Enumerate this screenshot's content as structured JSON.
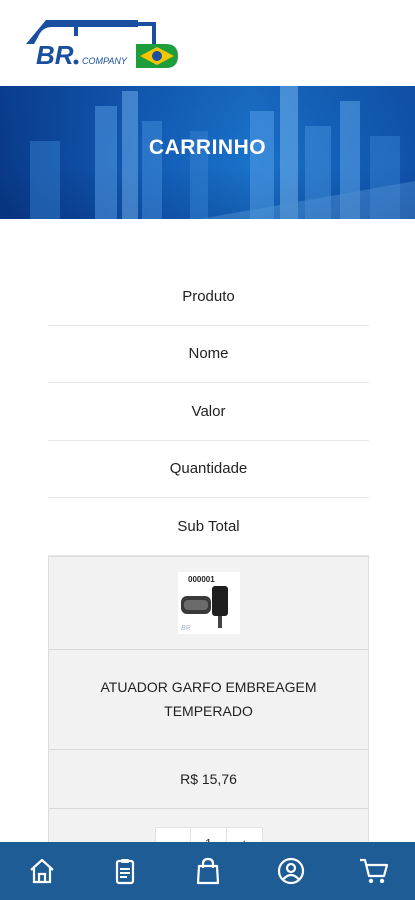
{
  "brand": {
    "logo_text": "BR",
    "logo_sub": "COMPANY"
  },
  "hero": {
    "title": "CARRINHO"
  },
  "cart": {
    "headers": [
      "Produto",
      "Nome",
      "Valor",
      "Quantidade",
      "Sub Total"
    ],
    "item": {
      "image_code": "000001",
      "image_brand": "BR",
      "name": "ATUADOR GARFO EMBREAGEM TEMPERADO",
      "price": "R$ 15,76",
      "qty_minus": "-",
      "qty_value": "1",
      "qty_plus": "+"
    }
  },
  "nav": {
    "items": [
      "home-icon",
      "orders-icon",
      "bag-icon",
      "account-icon",
      "cart-icon"
    ]
  },
  "colors": {
    "nav_bg": "#1e5c96",
    "brand_blue": "#1a4fa0",
    "brand_green": "#1f9d3a",
    "brand_yellow": "#f2c500"
  }
}
